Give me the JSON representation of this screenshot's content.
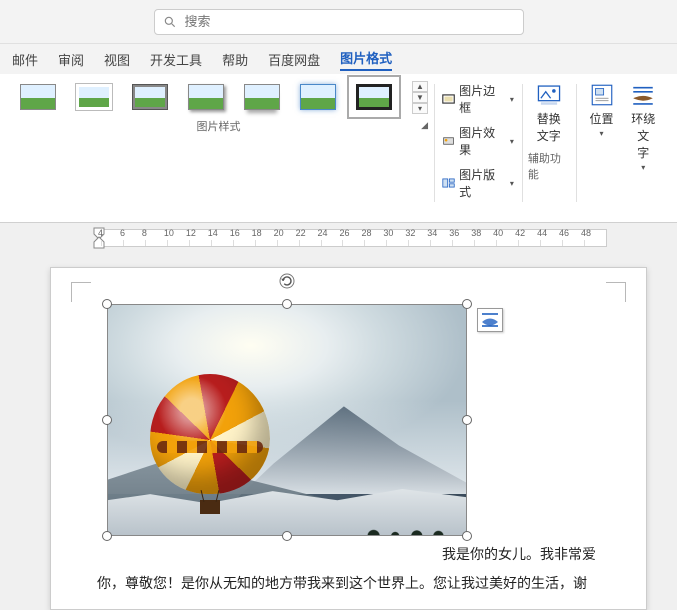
{
  "search": {
    "placeholder": "搜索"
  },
  "tabs": {
    "mail": "邮件",
    "review": "审阅",
    "view": "视图",
    "dev": "开发工具",
    "help": "帮助",
    "baidu": "百度网盘",
    "picformat": "图片格式"
  },
  "ribbon": {
    "styles_label": "图片样式",
    "border": "图片边框",
    "effects": "图片效果",
    "layout": "图片版式",
    "alt_text": "替换\n文字",
    "acc_label": "辅助功能",
    "position": "位置",
    "wrap": "环绕文\n字"
  },
  "ruler": {
    "ticks": [
      "4",
      "6",
      "8",
      "10",
      "12",
      "14",
      "16",
      "18",
      "20",
      "22",
      "24",
      "26",
      "28",
      "30",
      "32",
      "34",
      "36",
      "38",
      "40",
      "42",
      "44",
      "46",
      "48"
    ]
  },
  "doc": {
    "line1": "我是你的女儿。我非常爱",
    "line2": "你，尊敬您！是你从无知的地方带我来到这个世界上。您让我过美好的生活，谢"
  }
}
